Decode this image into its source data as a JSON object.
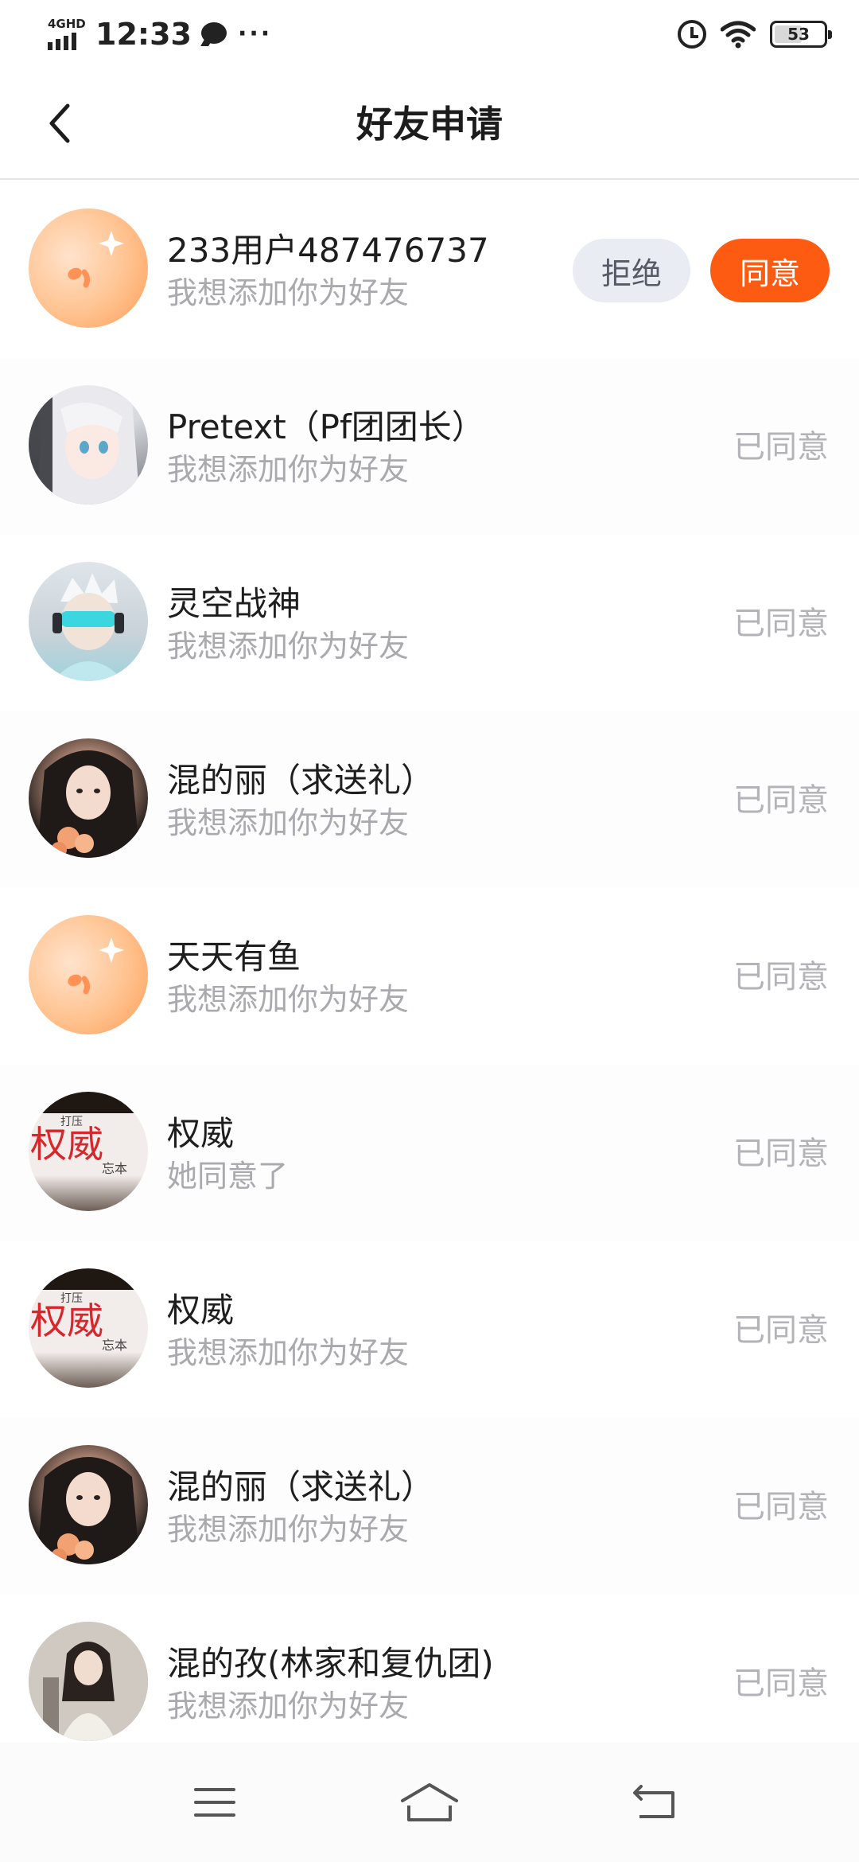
{
  "status_bar": {
    "network": "4GHD",
    "time": "12:33",
    "more": "···",
    "battery": "53"
  },
  "header": {
    "title": "好友申请"
  },
  "pending_request": {
    "name": "233用户487476737",
    "message": "我想添加你为好友",
    "reject_label": "拒绝",
    "accept_label": "同意"
  },
  "requests": [
    {
      "name": "Pretext（Pf团团长）",
      "message": "我想添加你为好友",
      "status": "已同意"
    },
    {
      "name": "灵空战神",
      "message": "我想添加你为好友",
      "status": "已同意"
    },
    {
      "name": "混的丽（求送礼）",
      "message": "我想添加你为好友",
      "status": "已同意"
    },
    {
      "name": "天天有鱼",
      "message": "我想添加你为好友",
      "status": "已同意"
    },
    {
      "name": "权威",
      "message": "她同意了",
      "status": "已同意"
    },
    {
      "name": "权威",
      "message": "我想添加你为好友",
      "status": "已同意"
    },
    {
      "name": "混的丽（求送礼）",
      "message": "我想添加你为好友",
      "status": "已同意"
    },
    {
      "name": "混的孜(林家和复仇团)",
      "message": "我想添加你为好友",
      "status": "已同意"
    }
  ],
  "avatar_signs": {
    "sign_main": "权威",
    "sign_small_top": "打压",
    "sign_small_bottom": "忘本"
  },
  "colors": {
    "accent": "#fe5b12",
    "reject_bg": "#e9ecf2",
    "muted_text": "#a9a9ae"
  }
}
